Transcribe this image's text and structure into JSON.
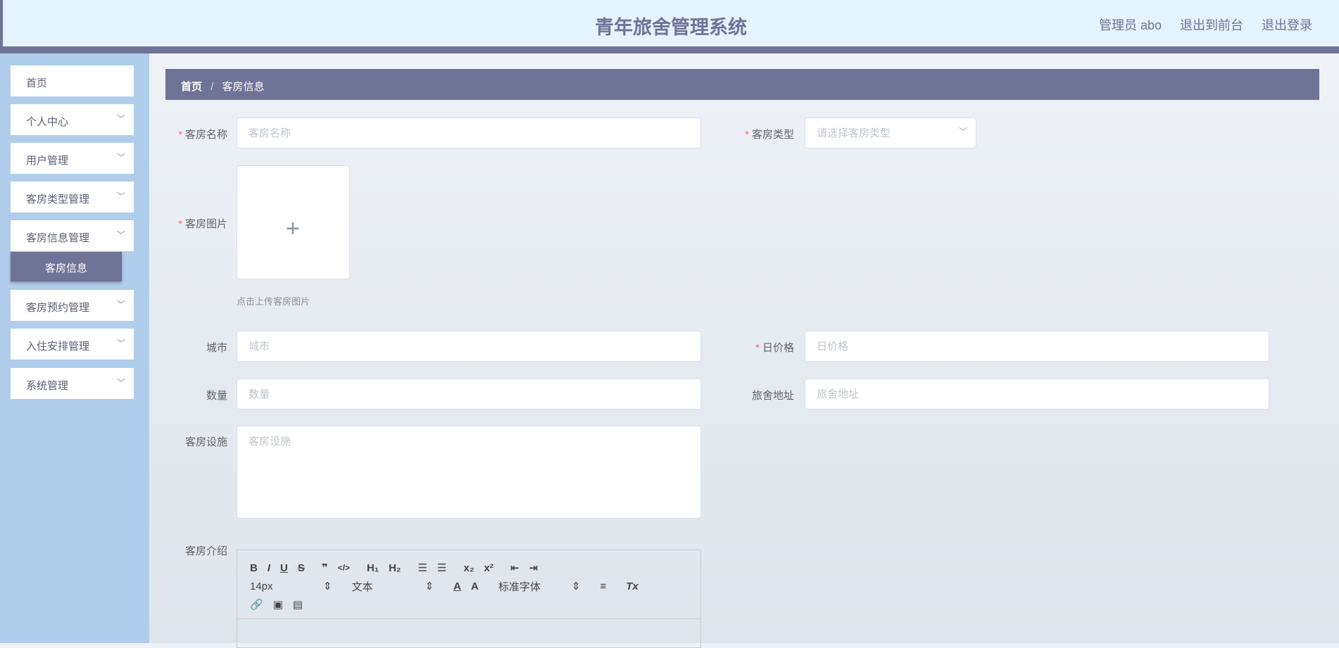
{
  "header": {
    "title": "青年旅舍管理系统",
    "user": "管理员 abo",
    "to_front": "退出到前台",
    "logout": "退出登录"
  },
  "sidebar": {
    "items": [
      {
        "label": "首页"
      },
      {
        "label": "个人中心"
      },
      {
        "label": "用户管理"
      },
      {
        "label": "客房类型管理"
      },
      {
        "label": "客房信息管理"
      },
      {
        "label": "客房预约管理"
      },
      {
        "label": "入住安排管理"
      },
      {
        "label": "系统管理"
      }
    ],
    "active_sub": "客房信息"
  },
  "breadcrumb": {
    "home": "首页",
    "sep": "/",
    "current": "客房信息"
  },
  "form": {
    "name": {
      "label": "客房名称",
      "placeholder": "客房名称"
    },
    "type": {
      "label": "客房类型",
      "placeholder": "请选择客房类型"
    },
    "image": {
      "label": "客房图片",
      "hint": "点击上传客房图片"
    },
    "city": {
      "label": "城市",
      "placeholder": "城市"
    },
    "price": {
      "label": "日价格",
      "placeholder": "日价格"
    },
    "qty": {
      "label": "数量",
      "placeholder": "数量"
    },
    "address": {
      "label": "旅舍地址",
      "placeholder": "旅舍地址"
    },
    "facilities": {
      "label": "客房设施",
      "placeholder": "客房设施"
    },
    "intro": {
      "label": "客房介绍"
    }
  },
  "editor": {
    "size": "14px",
    "header": "文本",
    "font": "标准字体"
  }
}
